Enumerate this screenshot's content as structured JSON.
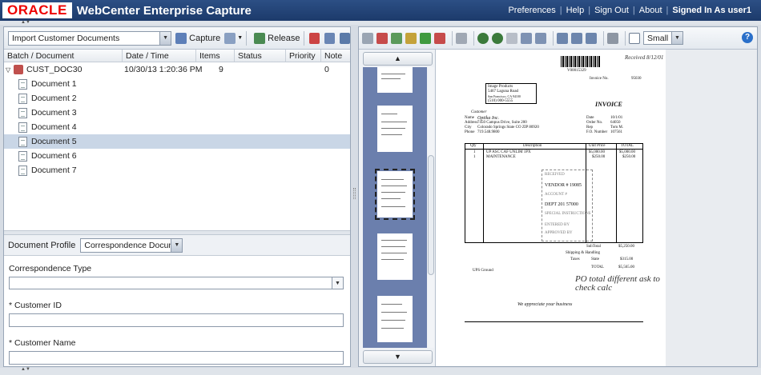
{
  "header": {
    "logo": "ORACLE",
    "title": "WebCenter Enterprise Capture",
    "links": [
      "Preferences",
      "Help",
      "Sign Out",
      "About"
    ],
    "user": "Signed In As user1"
  },
  "left_toolbar": {
    "batch_select": "Import Customer Documents",
    "capture_label": "Capture",
    "release_label": "Release"
  },
  "grid": {
    "columns": [
      "Batch / Document",
      "Date / Time",
      "Items",
      "Status",
      "Priority",
      "Note"
    ],
    "batch": {
      "name": "CUST_DOC30",
      "date": "10/30/13 1:20:36 PM",
      "items": "9",
      "status": "",
      "priority": "0",
      "note": ""
    },
    "documents": [
      "Document 1",
      "Document 2",
      "Document 3",
      "Document 4",
      "Document 5",
      "Document 6",
      "Document 7"
    ],
    "selected_index": 4
  },
  "profile": {
    "label": "Document Profile",
    "value": "Correspondence Documents"
  },
  "form": {
    "correspondence_type_label": "Correspondence Type",
    "correspondence_type_value": "",
    "customer_id_label": "* Customer ID",
    "customer_id_value": "",
    "customer_name_label": "* Customer Name",
    "customer_name_value": ""
  },
  "viewer_toolbar": {
    "size_select": "Small",
    "help": "?"
  },
  "invoice": {
    "number_label": "Invoice No.",
    "number": "95030",
    "barcode_text": "V00015329",
    "title": "INVOICE",
    "bill_to": [
      "Image Products",
      "5467 Laguna Road",
      "San Francisco, CA 94100",
      "(510) 000-5555"
    ],
    "customer_heading": "Customer",
    "customer_name": "Optika Inc.",
    "customer_lines": [
      "7450 Campus Drive, Suite 200",
      "Colorado Springs   State CO   ZIP 80920",
      "719.548.9800"
    ],
    "customer_labels": [
      "Name",
      "Address",
      "City",
      "Phone"
    ],
    "meta_labels": [
      "Date",
      "Order No.",
      "Rep",
      "F.O. Number"
    ],
    "meta_values": [
      "10/1/01",
      "64050",
      "Tom M.",
      "107561"
    ],
    "table_headers": [
      "Qty",
      "Description",
      "Unit Price",
      "TOTAL"
    ],
    "lines": [
      {
        "qty": "1",
        "desc": "UP ASC CAF UNLIM 1PX",
        "unit": "$5,000.00",
        "total": "$5,000.00"
      },
      {
        "qty": "1",
        "desc": "MAINTENANCE",
        "unit": "$250.00",
        "total": "$250.00"
      }
    ],
    "subtotal_label": "SubTotal",
    "subtotal": "$5,250.00",
    "shipping_label": "Shipping & Handling",
    "taxes_label": "Taxes",
    "taxes_state": "State",
    "taxes": "$315.00",
    "total_label": "TOTAL",
    "total": "$5,565.00",
    "ship_method": "UPS Ground",
    "thanks": "We appreciate your business",
    "stamp_lines": [
      "RECEIVED",
      "VENDOR # 19085",
      "ACCOUNT #",
      "DEPT 201 57000",
      "SPECIAL INSTRUCTIONS",
      "ENTERED BY",
      "APPROVED BY"
    ],
    "handwriting_top": "Received 8/12/01",
    "handwriting_bottom": "PO total different ask to check calc"
  }
}
